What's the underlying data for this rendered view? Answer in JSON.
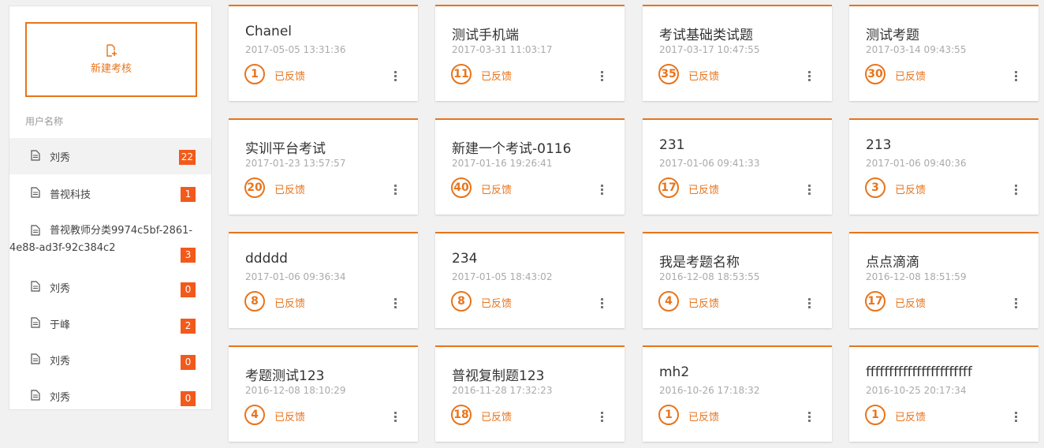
{
  "colors": {
    "accent": "#e8741b",
    "badge": "#f25a1c"
  },
  "sidebar": {
    "new_button_label": "新建考核",
    "new_button_icon": "add-file-icon",
    "section_label": "用户名称",
    "items": [
      {
        "label": "刘秀",
        "count": "22",
        "active": true
      },
      {
        "label": "普视科技",
        "count": "1"
      },
      {
        "label": "普视教师分类9974c5bf-2861-4e88-ad3f-92c384c2",
        "count": "3"
      },
      {
        "label": "刘秀",
        "count": "0"
      },
      {
        "label": "于峰",
        "count": "2"
      },
      {
        "label": "刘秀",
        "count": "0"
      },
      {
        "label": "刘秀",
        "count": "0"
      }
    ]
  },
  "cards": [
    {
      "title": "Chanel",
      "date": "2017-05-05 13:31:36",
      "count": "1",
      "status": "已反馈"
    },
    {
      "title": "测试手机端",
      "date": "2017-03-31 11:03:17",
      "count": "11",
      "status": "已反馈"
    },
    {
      "title": "考试基础类试题",
      "date": "2017-03-17 10:47:55",
      "count": "35",
      "status": "已反馈"
    },
    {
      "title": "测试考题",
      "date": "2017-03-14 09:43:55",
      "count": "30",
      "status": "已反馈"
    },
    {
      "title": "实训平台考试",
      "date": "2017-01-23 13:57:57",
      "count": "20",
      "status": "已反馈"
    },
    {
      "title": "新建一个考试-0116",
      "date": "2017-01-16 19:26:41",
      "count": "40",
      "status": "已反馈"
    },
    {
      "title": "231",
      "date": "2017-01-06 09:41:33",
      "count": "17",
      "status": "已反馈"
    },
    {
      "title": "213",
      "date": "2017-01-06 09:40:36",
      "count": "3",
      "status": "已反馈"
    },
    {
      "title": "ddddd",
      "date": "2017-01-06 09:36:34",
      "count": "8",
      "status": "已反馈"
    },
    {
      "title": "234",
      "date": "2017-01-05 18:43:02",
      "count": "8",
      "status": "已反馈"
    },
    {
      "title": "我是考题名称",
      "date": "2016-12-08 18:53:55",
      "count": "4",
      "status": "已反馈"
    },
    {
      "title": "点点滴滴",
      "date": "2016-12-08 18:51:59",
      "count": "17",
      "status": "已反馈"
    },
    {
      "title": "考题测试123",
      "date": "2016-12-08 18:10:29",
      "count": "4",
      "status": "已反馈"
    },
    {
      "title": "普视复制题123",
      "date": "2016-11-28 17:32:23",
      "count": "18",
      "status": "已反馈"
    },
    {
      "title": "mh2",
      "date": "2016-10-26 17:18:32",
      "count": "1",
      "status": "已反馈"
    },
    {
      "title": "fffffffffffffffffffffff",
      "date": "2016-10-25 20:17:34",
      "count": "1",
      "status": "已反馈"
    }
  ]
}
